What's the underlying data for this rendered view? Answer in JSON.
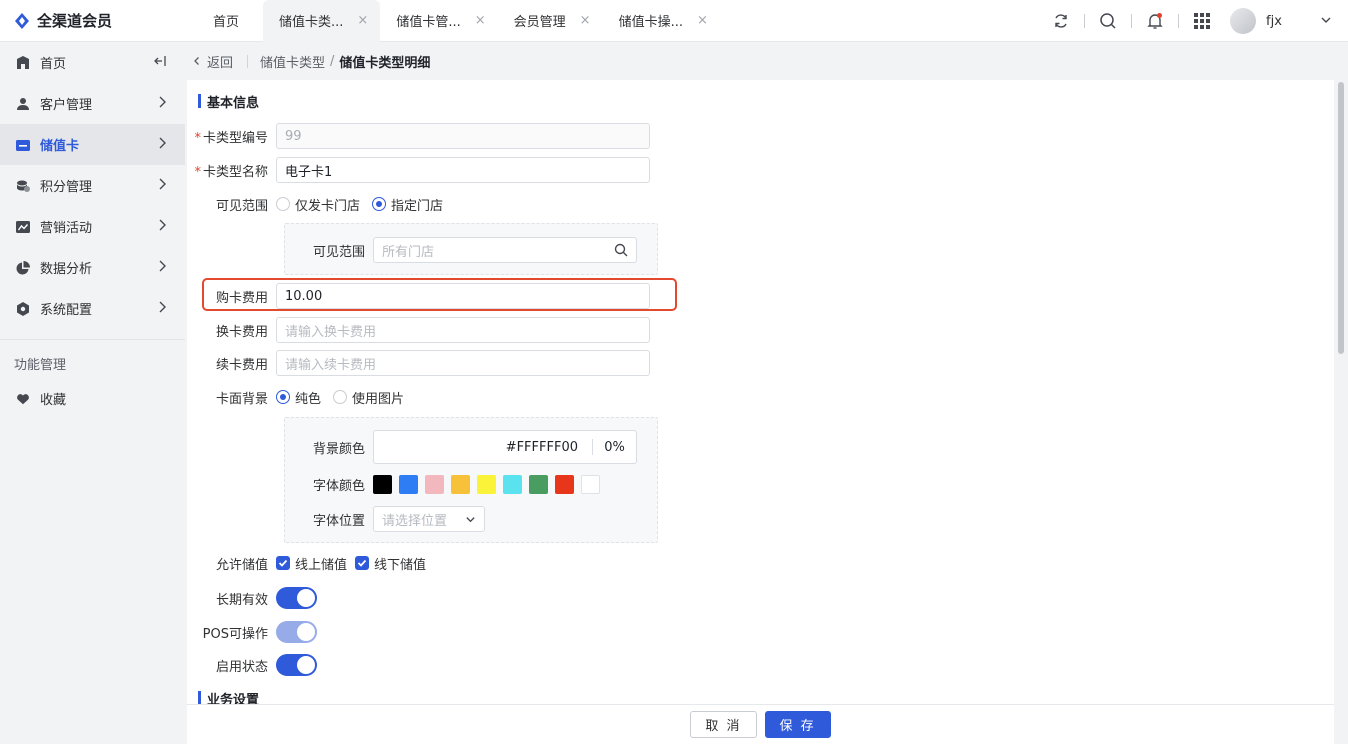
{
  "app": {
    "title": "全渠道会员"
  },
  "tabs": [
    {
      "label": "首页"
    },
    {
      "label": "储值卡类..."
    },
    {
      "label": "储值卡管..."
    },
    {
      "label": "会员管理"
    },
    {
      "label": "储值卡操..."
    }
  ],
  "tab_close": "×",
  "user": {
    "name": "fjx"
  },
  "sidebar": {
    "items": [
      {
        "label": "首页",
        "icon": "home-icon"
      },
      {
        "label": "客户管理",
        "icon": "user-icon"
      },
      {
        "label": "储值卡",
        "icon": "card-icon"
      },
      {
        "label": "积分管理",
        "icon": "points-icon"
      },
      {
        "label": "营销活动",
        "icon": "marketing-icon"
      },
      {
        "label": "数据分析",
        "icon": "pie-icon"
      },
      {
        "label": "系统配置",
        "icon": "settings-icon"
      }
    ],
    "section_title": "功能管理",
    "favorites": "收藏"
  },
  "breadcrumb": {
    "back": "返回",
    "parent": "储值卡类型",
    "separator": "/",
    "current": "储值卡类型明细"
  },
  "form": {
    "section_basic": "基本信息",
    "card_type_code": {
      "label": "卡类型编号",
      "value": "99"
    },
    "card_type_name": {
      "label": "卡类型名称",
      "value": "电子卡1"
    },
    "visibility": {
      "label": "可见范围",
      "option_a": "仅发卡门店",
      "option_b": "指定门店",
      "selected": "指定门店"
    },
    "visible_stores": {
      "label": "可见范围",
      "placeholder": "所有门店"
    },
    "purchase_fee": {
      "label": "购卡费用",
      "value": "10.00"
    },
    "exchange_fee": {
      "label": "换卡费用",
      "placeholder": "请输入换卡费用"
    },
    "renew_fee": {
      "label": "续卡费用",
      "placeholder": "请输入续卡费用"
    },
    "background": {
      "label": "卡面背景",
      "option_a": "纯色",
      "option_b": "使用图片",
      "selected": "纯色"
    },
    "bg_color": {
      "label": "背景颜色",
      "hex": "#FFFFFF00",
      "opacity": "0%"
    },
    "font_color": {
      "label": "字体颜色",
      "swatches": [
        "#000000",
        "#2e7df5",
        "#f2b8bd",
        "#f7c23a",
        "#fbf23a",
        "#5ae3ee",
        "#4a9d60",
        "#e8361a",
        "#ffffff"
      ]
    },
    "font_position": {
      "label": "字体位置",
      "placeholder": "请选择位置"
    },
    "allow_stored_value": {
      "label": "允许储值",
      "online": "线上储值",
      "offline": "线下储值"
    },
    "long_term": {
      "label": "长期有效",
      "on": true
    },
    "pos_operable": {
      "label": "POS可操作",
      "on": true
    },
    "enabled": {
      "label": "启用状态",
      "on": true
    },
    "section_business": "业务设置"
  },
  "footer": {
    "cancel": "取 消",
    "save": "保 存"
  },
  "colors": {
    "primary": "#2f5ad9",
    "highlight": "#e2492f",
    "required": "#e3402b"
  }
}
